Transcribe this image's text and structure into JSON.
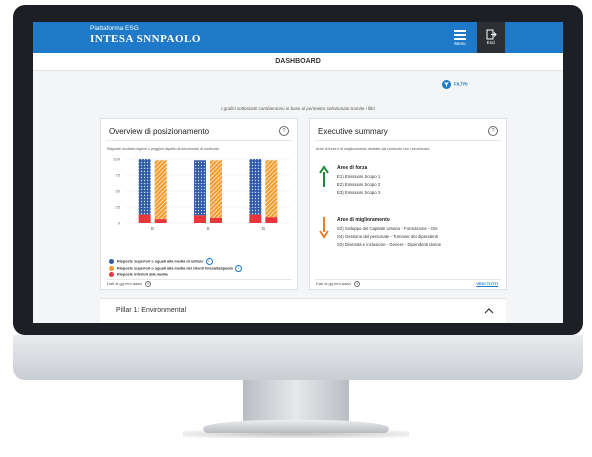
{
  "header": {
    "logo_sub": "Piattaforma ESG",
    "logo_main": "INTESA SNNPAOLO",
    "menu_label": "Menu",
    "exit_label": "Esci",
    "brand_color": "#1e7ac8"
  },
  "page_title": "DASHBOARD",
  "filter_label": "FILTRI",
  "note": "I grafici sottostanti cambieranno in base al perimetro selezionato tramite i filtri",
  "overview": {
    "title": "Overview di posizionamento",
    "subtitle": "Risposte risultate migliori o peggiori rispetto al benchmark di confronto",
    "footer": "Dati al gg.mm.aaaa",
    "legend": [
      {
        "label": "Risposte superiori o uguali alla media di settore",
        "color": "#2f5aa8"
      },
      {
        "label": "Risposte superiori o uguali alla media dei clienti IntesaSanpaolo",
        "color": "#f29a2e"
      },
      {
        "label": "Risposte inferiori alla media",
        "color": "#e8363a"
      }
    ]
  },
  "chart_data": {
    "type": "bar",
    "categories": [
      "E",
      "S",
      "G"
    ],
    "yticks": [
      "100",
      "75",
      "50",
      "25",
      "0"
    ],
    "ylim": [
      0,
      100
    ],
    "series": [
      {
        "name": "Risposte superiori o uguali alla media di settore",
        "color": "#2f5aa8",
        "values": [
          87,
          86,
          88
        ],
        "below": [
          13,
          12,
          13
        ]
      },
      {
        "name": "Risposte superiori o uguali alla media dei clienti IntesaSanpaolo",
        "color": "#f29a2e",
        "values": [
          92,
          90,
          89
        ],
        "below": [
          6,
          8,
          9
        ]
      }
    ],
    "below_color": "#e8363a"
  },
  "summary": {
    "title": "Executive summary",
    "subtitle": "Aree di forza e di miglioramento risultate dal confronto con i benchmark",
    "strengths_title": "Aree di forza",
    "strengths": [
      "E1) Emissioni Scopo 1",
      "E2) Emissioni Scopo 2",
      "E3) Emissioni Scopo 3"
    ],
    "improve_title": "Aree di miglioramento",
    "improvements": [
      "S2) Sviluppo del Capitale Umano - Formazione - Ore",
      "S4) Gestione del personale - Turnover dei dipendenti",
      "S3) Diversità e inclusione - Genere - Dipendenti donne"
    ],
    "footer": "Dati al gg.mm.aaaa",
    "see_all": "VEDI TUTTI"
  },
  "pillar": {
    "label": "Pillar 1: Environmental"
  }
}
